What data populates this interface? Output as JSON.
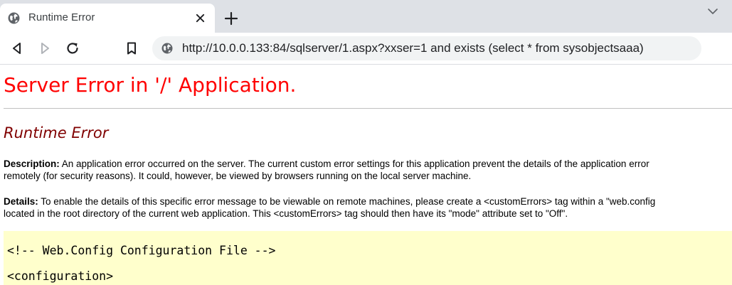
{
  "browser": {
    "tab": {
      "title": "Runtime Error",
      "favicon": "globe-icon"
    },
    "icons": {
      "tab_close": "close-icon",
      "new_tab": "plus-icon",
      "tab_search": "chevron-down-icon",
      "back": "back-arrow-icon",
      "forward": "forward-arrow-icon",
      "reload": "reload-icon",
      "bookmark": "bookmark-icon",
      "site_info": "globe-icon"
    },
    "address_bar": {
      "url": "http://10.0.0.133:84/sqlserver/1.aspx?xxser=1 and exists (select * from sysobjectsaaa)"
    }
  },
  "page": {
    "heading": "Server Error in '/' Application.",
    "subheading": "Runtime Error",
    "description": {
      "label": "Description:",
      "line1": " An application error occurred on the server. The current custom error settings for this application prevent the details of the application error",
      "line2": "remotely (for security reasons). It could, however, be viewed by browsers running on the local server machine."
    },
    "details": {
      "label": "Details:",
      "line1": " To enable the details of this specific error message to be viewable on remote machines, please create a <customErrors> tag within a \"web.config",
      "line2": "located in the root directory of the current web application. This <customErrors> tag should then have its \"mode\" attribute set to \"Off\"."
    },
    "code": {
      "line1": "<!-- Web.Config Configuration File -->",
      "line2": "<configuration>"
    }
  },
  "colors": {
    "heading": "#ff0000",
    "subheading": "#800000",
    "code_background": "#ffffcc",
    "tabstrip": "#dee1e6",
    "omnibox": "#f1f3f4"
  }
}
